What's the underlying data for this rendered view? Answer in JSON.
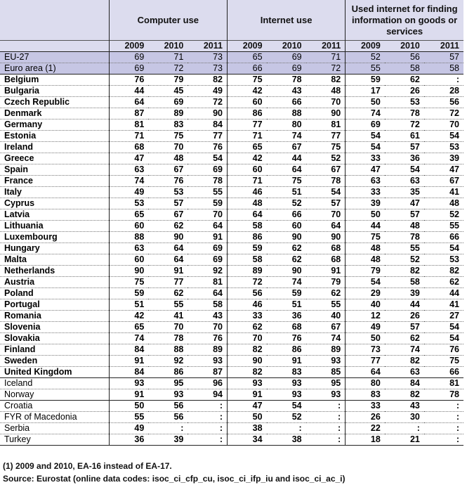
{
  "headers": {
    "groups": [
      "Computer use",
      "Internet use",
      "Used internet for finding information on goods or services"
    ],
    "years": [
      "2009",
      "2010",
      "2011"
    ]
  },
  "rows": [
    {
      "label": "EU-27",
      "values": [
        "69",
        "71",
        "73",
        "65",
        "69",
        "71",
        "52",
        "56",
        "57"
      ],
      "type": "agg"
    },
    {
      "label": "Euro area (1)",
      "values": [
        "69",
        "72",
        "73",
        "66",
        "69",
        "72",
        "55",
        "58",
        "58"
      ],
      "type": "agg",
      "end": true
    },
    {
      "label": "Belgium",
      "values": [
        "76",
        "79",
        "82",
        "75",
        "78",
        "82",
        "59",
        "62",
        ":"
      ]
    },
    {
      "label": "Bulgaria",
      "values": [
        "44",
        "45",
        "49",
        "42",
        "43",
        "48",
        "17",
        "26",
        "28"
      ]
    },
    {
      "label": "Czech Republic",
      "values": [
        "64",
        "69",
        "72",
        "60",
        "66",
        "70",
        "50",
        "53",
        "56"
      ]
    },
    {
      "label": "Denmark",
      "values": [
        "87",
        "89",
        "90",
        "86",
        "88",
        "90",
        "74",
        "78",
        "72"
      ]
    },
    {
      "label": "Germany",
      "values": [
        "81",
        "83",
        "84",
        "77",
        "80",
        "81",
        "69",
        "72",
        "70"
      ]
    },
    {
      "label": "Estonia",
      "values": [
        "71",
        "75",
        "77",
        "71",
        "74",
        "77",
        "54",
        "61",
        "54"
      ]
    },
    {
      "label": "Ireland",
      "values": [
        "68",
        "70",
        "76",
        "65",
        "67",
        "75",
        "54",
        "57",
        "53"
      ]
    },
    {
      "label": "Greece",
      "values": [
        "47",
        "48",
        "54",
        "42",
        "44",
        "52",
        "33",
        "36",
        "39"
      ]
    },
    {
      "label": "Spain",
      "values": [
        "63",
        "67",
        "69",
        "60",
        "64",
        "67",
        "47",
        "54",
        "47"
      ]
    },
    {
      "label": "France",
      "values": [
        "74",
        "76",
        "78",
        "71",
        "75",
        "78",
        "63",
        "63",
        "67"
      ]
    },
    {
      "label": "Italy",
      "values": [
        "49",
        "53",
        "55",
        "46",
        "51",
        "54",
        "33",
        "35",
        "41"
      ]
    },
    {
      "label": "Cyprus",
      "values": [
        "53",
        "57",
        "59",
        "48",
        "52",
        "57",
        "39",
        "47",
        "48"
      ]
    },
    {
      "label": "Latvia",
      "values": [
        "65",
        "67",
        "70",
        "64",
        "66",
        "70",
        "50",
        "57",
        "52"
      ]
    },
    {
      "label": "Lithuania",
      "values": [
        "60",
        "62",
        "64",
        "58",
        "60",
        "64",
        "44",
        "48",
        "55"
      ]
    },
    {
      "label": "Luxembourg",
      "values": [
        "88",
        "90",
        "91",
        "86",
        "90",
        "90",
        "75",
        "78",
        "66"
      ]
    },
    {
      "label": "Hungary",
      "values": [
        "63",
        "64",
        "69",
        "59",
        "62",
        "68",
        "48",
        "55",
        "54"
      ]
    },
    {
      "label": "Malta",
      "values": [
        "60",
        "64",
        "69",
        "58",
        "62",
        "68",
        "48",
        "52",
        "53"
      ]
    },
    {
      "label": "Netherlands",
      "values": [
        "90",
        "91",
        "92",
        "89",
        "90",
        "91",
        "79",
        "82",
        "82"
      ]
    },
    {
      "label": "Austria",
      "values": [
        "75",
        "77",
        "81",
        "72",
        "74",
        "79",
        "54",
        "58",
        "62"
      ]
    },
    {
      "label": "Poland",
      "values": [
        "59",
        "62",
        "64",
        "56",
        "59",
        "62",
        "29",
        "39",
        "44"
      ]
    },
    {
      "label": "Portugal",
      "values": [
        "51",
        "55",
        "58",
        "46",
        "51",
        "55",
        "40",
        "44",
        "41"
      ]
    },
    {
      "label": "Romania",
      "values": [
        "42",
        "41",
        "43",
        "33",
        "36",
        "40",
        "12",
        "26",
        "27"
      ]
    },
    {
      "label": "Slovenia",
      "values": [
        "65",
        "70",
        "70",
        "62",
        "68",
        "67",
        "49",
        "57",
        "54"
      ]
    },
    {
      "label": "Slovakia",
      "values": [
        "74",
        "78",
        "76",
        "70",
        "76",
        "74",
        "50",
        "62",
        "54"
      ]
    },
    {
      "label": "Finland",
      "values": [
        "84",
        "88",
        "89",
        "82",
        "86",
        "89",
        "73",
        "74",
        "76"
      ]
    },
    {
      "label": "Sweden",
      "values": [
        "91",
        "92",
        "93",
        "90",
        "91",
        "93",
        "77",
        "82",
        "75"
      ]
    },
    {
      "label": "United Kingdom",
      "values": [
        "84",
        "86",
        "87",
        "82",
        "83",
        "85",
        "64",
        "63",
        "66"
      ],
      "end": true
    },
    {
      "label": "Iceland",
      "values": [
        "93",
        "95",
        "96",
        "93",
        "93",
        "95",
        "80",
        "84",
        "81"
      ],
      "type": "plain"
    },
    {
      "label": "Norway",
      "values": [
        "91",
        "93",
        "94",
        "91",
        "93",
        "93",
        "83",
        "82",
        "78"
      ],
      "type": "plain",
      "end": true
    },
    {
      "label": "Croatia",
      "values": [
        "50",
        "56",
        ":",
        "47",
        "54",
        ":",
        "33",
        "43",
        ":"
      ],
      "type": "plain"
    },
    {
      "label": "FYR of Macedonia",
      "values": [
        "55",
        "56",
        ":",
        "50",
        "52",
        ":",
        "26",
        "30",
        ":"
      ],
      "type": "plain"
    },
    {
      "label": "Serbia",
      "values": [
        "49",
        ":",
        ":",
        "38",
        ":",
        ":",
        "22",
        ":",
        ":"
      ],
      "type": "plain"
    },
    {
      "label": "Turkey",
      "values": [
        "36",
        "39",
        ":",
        "34",
        "38",
        ":",
        "18",
        "21",
        ":"
      ],
      "type": "plain",
      "end": true
    }
  ],
  "notes": {
    "footnote": "(1) 2009 and 2010, EA-16 instead of EA-17.",
    "source": "Source: Eurostat (online data codes: isoc_ci_cfp_cu, isoc_ci_ifp_iu and isoc_ci_ac_i)"
  }
}
